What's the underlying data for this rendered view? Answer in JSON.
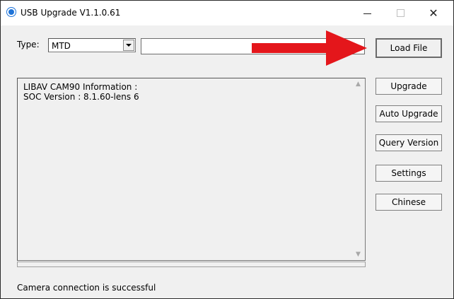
{
  "window": {
    "title": "USB Upgrade V1.1.0.61"
  },
  "titlebar": {
    "minimize": "—",
    "close": "✕"
  },
  "form": {
    "type_label": "Type:",
    "type_value": "MTD",
    "file_path": ""
  },
  "buttons": {
    "load_file": "Load File",
    "upgrade": "Upgrade",
    "auto_upgrade": "Auto Upgrade",
    "query_version": "Query Version",
    "settings": "Settings",
    "chinese": "Chinese"
  },
  "info": {
    "line1": "LIBAV CAM90 Information :",
    "line2": "SOC Version : 8.1.60-lens 6"
  },
  "status": {
    "message": "Camera connection is successful"
  },
  "colors": {
    "annotation_arrow": "#e4161b",
    "app_icon": "#1e73d8"
  }
}
